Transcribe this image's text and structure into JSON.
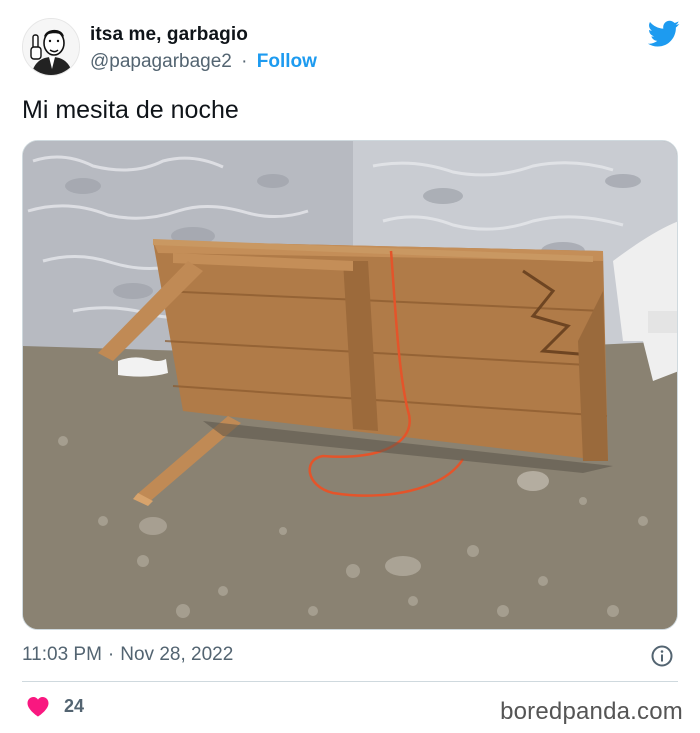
{
  "tweet": {
    "author": {
      "name": "itsa me, garbagio",
      "handle": "@papagarbage2",
      "separator": "·",
      "follow_label": "Follow",
      "avatar_icon": "vintage-man-avatar-icon"
    },
    "brand_icon": "twitter-bird-icon",
    "text": "Mi mesita de noche",
    "media": {
      "kind": "photo-broken-wooden-table"
    },
    "date": {
      "time": "11:03 PM",
      "separator": "·",
      "day": "Nov 28, 2022"
    },
    "info_icon": "info-circle-icon",
    "likes": {
      "icon": "heart-icon",
      "count": "24"
    }
  },
  "watermark": "boredpanda.com",
  "colors": {
    "accent": "#1d9bf0",
    "heart": "#f91880",
    "secondary_text": "#536471",
    "text": "#0f1419",
    "border": "#cfd9de"
  }
}
